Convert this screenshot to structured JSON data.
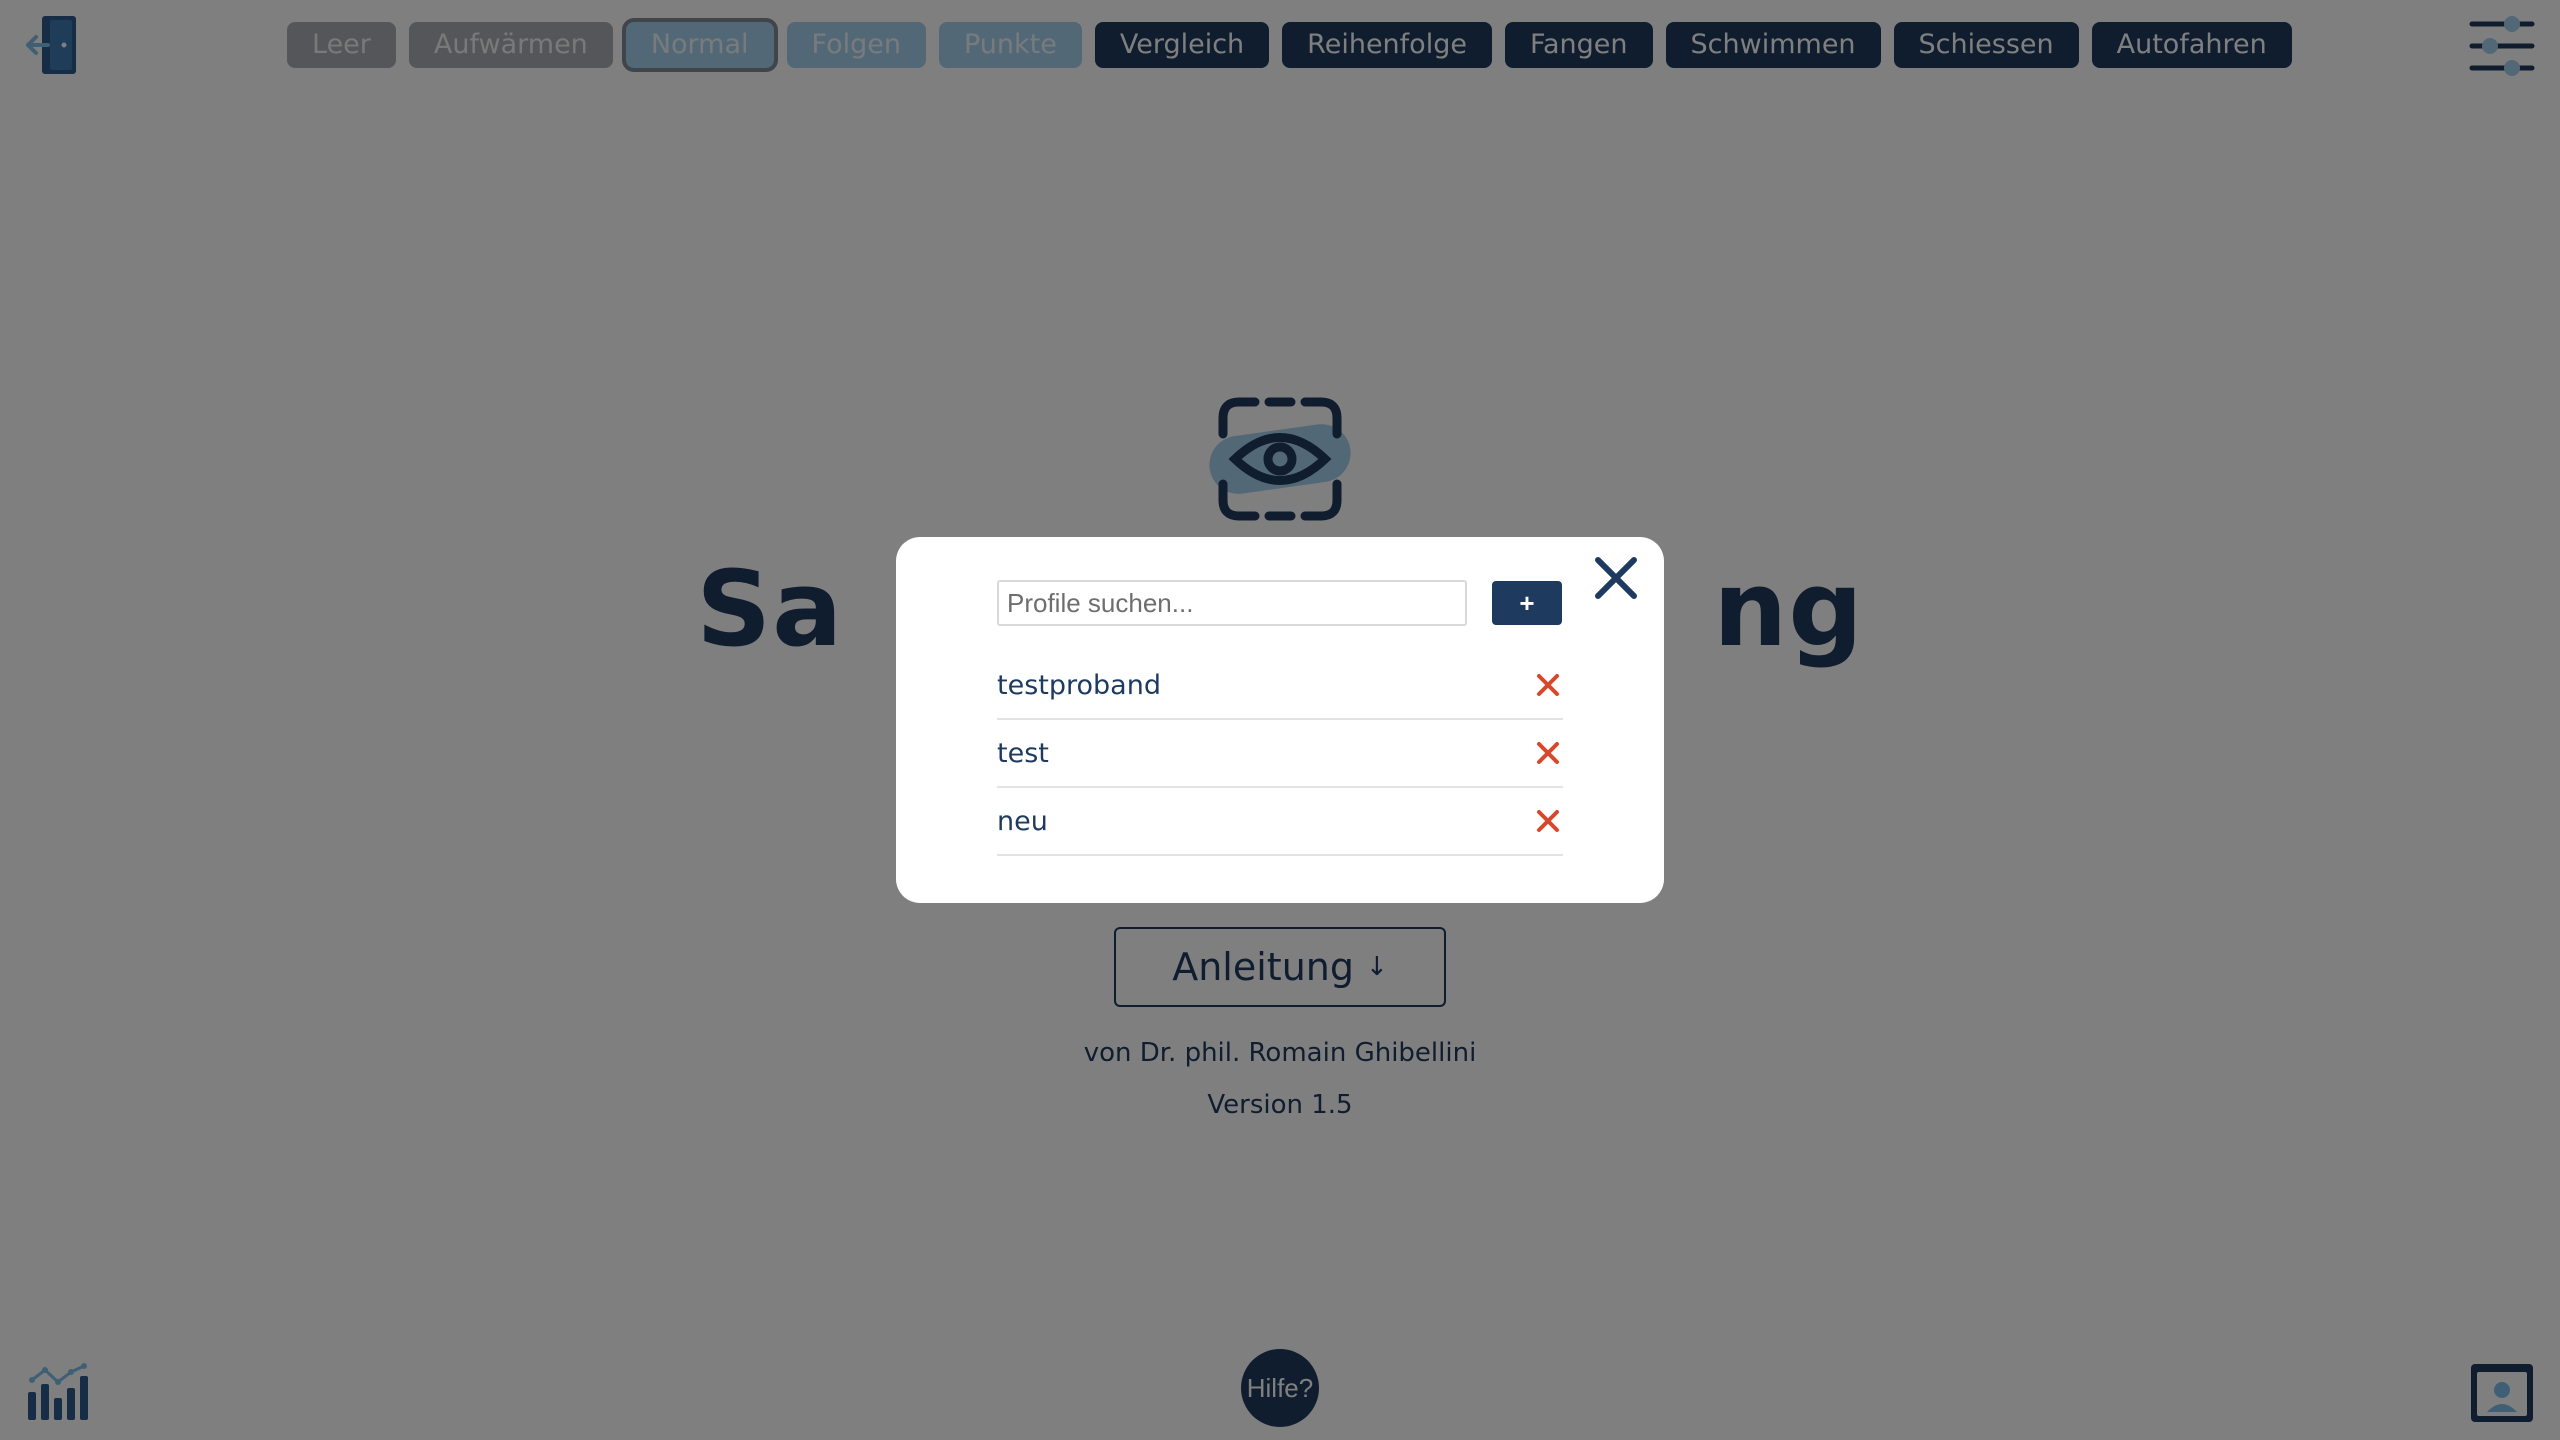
{
  "app": {
    "title_fragment_left": "Sa",
    "title_fragment_right": "ng"
  },
  "nav": {
    "modes": [
      {
        "label": "Leer",
        "state": "disabled-grey"
      },
      {
        "label": "Aufwärmen",
        "state": "disabled-grey"
      },
      {
        "label": "Normal",
        "state": "active"
      },
      {
        "label": "Folgen",
        "state": "light"
      },
      {
        "label": "Punkte",
        "state": "light"
      },
      {
        "label": "Vergleich",
        "state": "dark"
      },
      {
        "label": "Reihenfolge",
        "state": "dark"
      },
      {
        "label": "Fangen",
        "state": "dark"
      },
      {
        "label": "Schwimmen",
        "state": "dark"
      },
      {
        "label": "Schiessen",
        "state": "dark"
      },
      {
        "label": "Autofahren",
        "state": "dark"
      }
    ],
    "icons": {
      "exit": "exit-door-icon",
      "settings": "sliders-icon"
    }
  },
  "hero": {
    "logo_icon": "eye-scan-icon",
    "guide_button": "Anleitung",
    "guide_arrow": "↓",
    "author": "von Dr. phil. Romain Ghibellini",
    "version": "Version 1.5"
  },
  "bottom": {
    "help_label": "Hilfe?",
    "icons": {
      "stats": "bar-chart-icon",
      "profile": "profile-card-icon"
    }
  },
  "profile_modal": {
    "search_placeholder": "Profile suchen...",
    "search_value": "",
    "add_label": "+",
    "profiles": [
      {
        "name": "testproband"
      },
      {
        "name": "test"
      },
      {
        "name": "neu"
      }
    ]
  },
  "colors": {
    "primary": "#1f3a5f",
    "accent_light": "#a6d0ee",
    "grey_button": "#a9adb2",
    "delete": "#d9472b",
    "overlay": "rgba(0,0,0,0.5)"
  }
}
